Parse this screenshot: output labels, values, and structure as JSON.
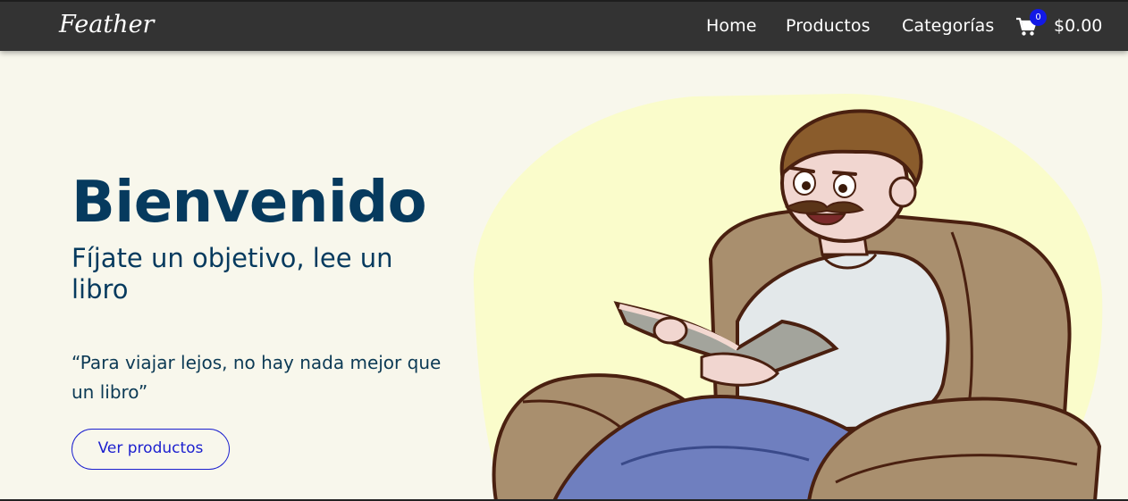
{
  "nav": {
    "brand": "Feather",
    "links": [
      {
        "label": "Home"
      },
      {
        "label": "Productos"
      },
      {
        "label": "Categorías"
      }
    ],
    "cart": {
      "count": "0",
      "total": "$0.00",
      "icon": "shopping-cart-icon"
    }
  },
  "hero": {
    "title": "Bienvenido",
    "subtitle": "Fíjate un objetivo, lee un libro",
    "quote": "“Para viajar lejos, no hay nada mejor que un libro”",
    "cta_label": "Ver productos",
    "illustration": "man-reading-book-in-armchair"
  },
  "colors": {
    "navbar": "#333333",
    "background": "#f8f7ec",
    "heading": "#063a5e",
    "accent": "#1b1fcf",
    "badge": "#1219e6",
    "blob": "#fafccb"
  }
}
